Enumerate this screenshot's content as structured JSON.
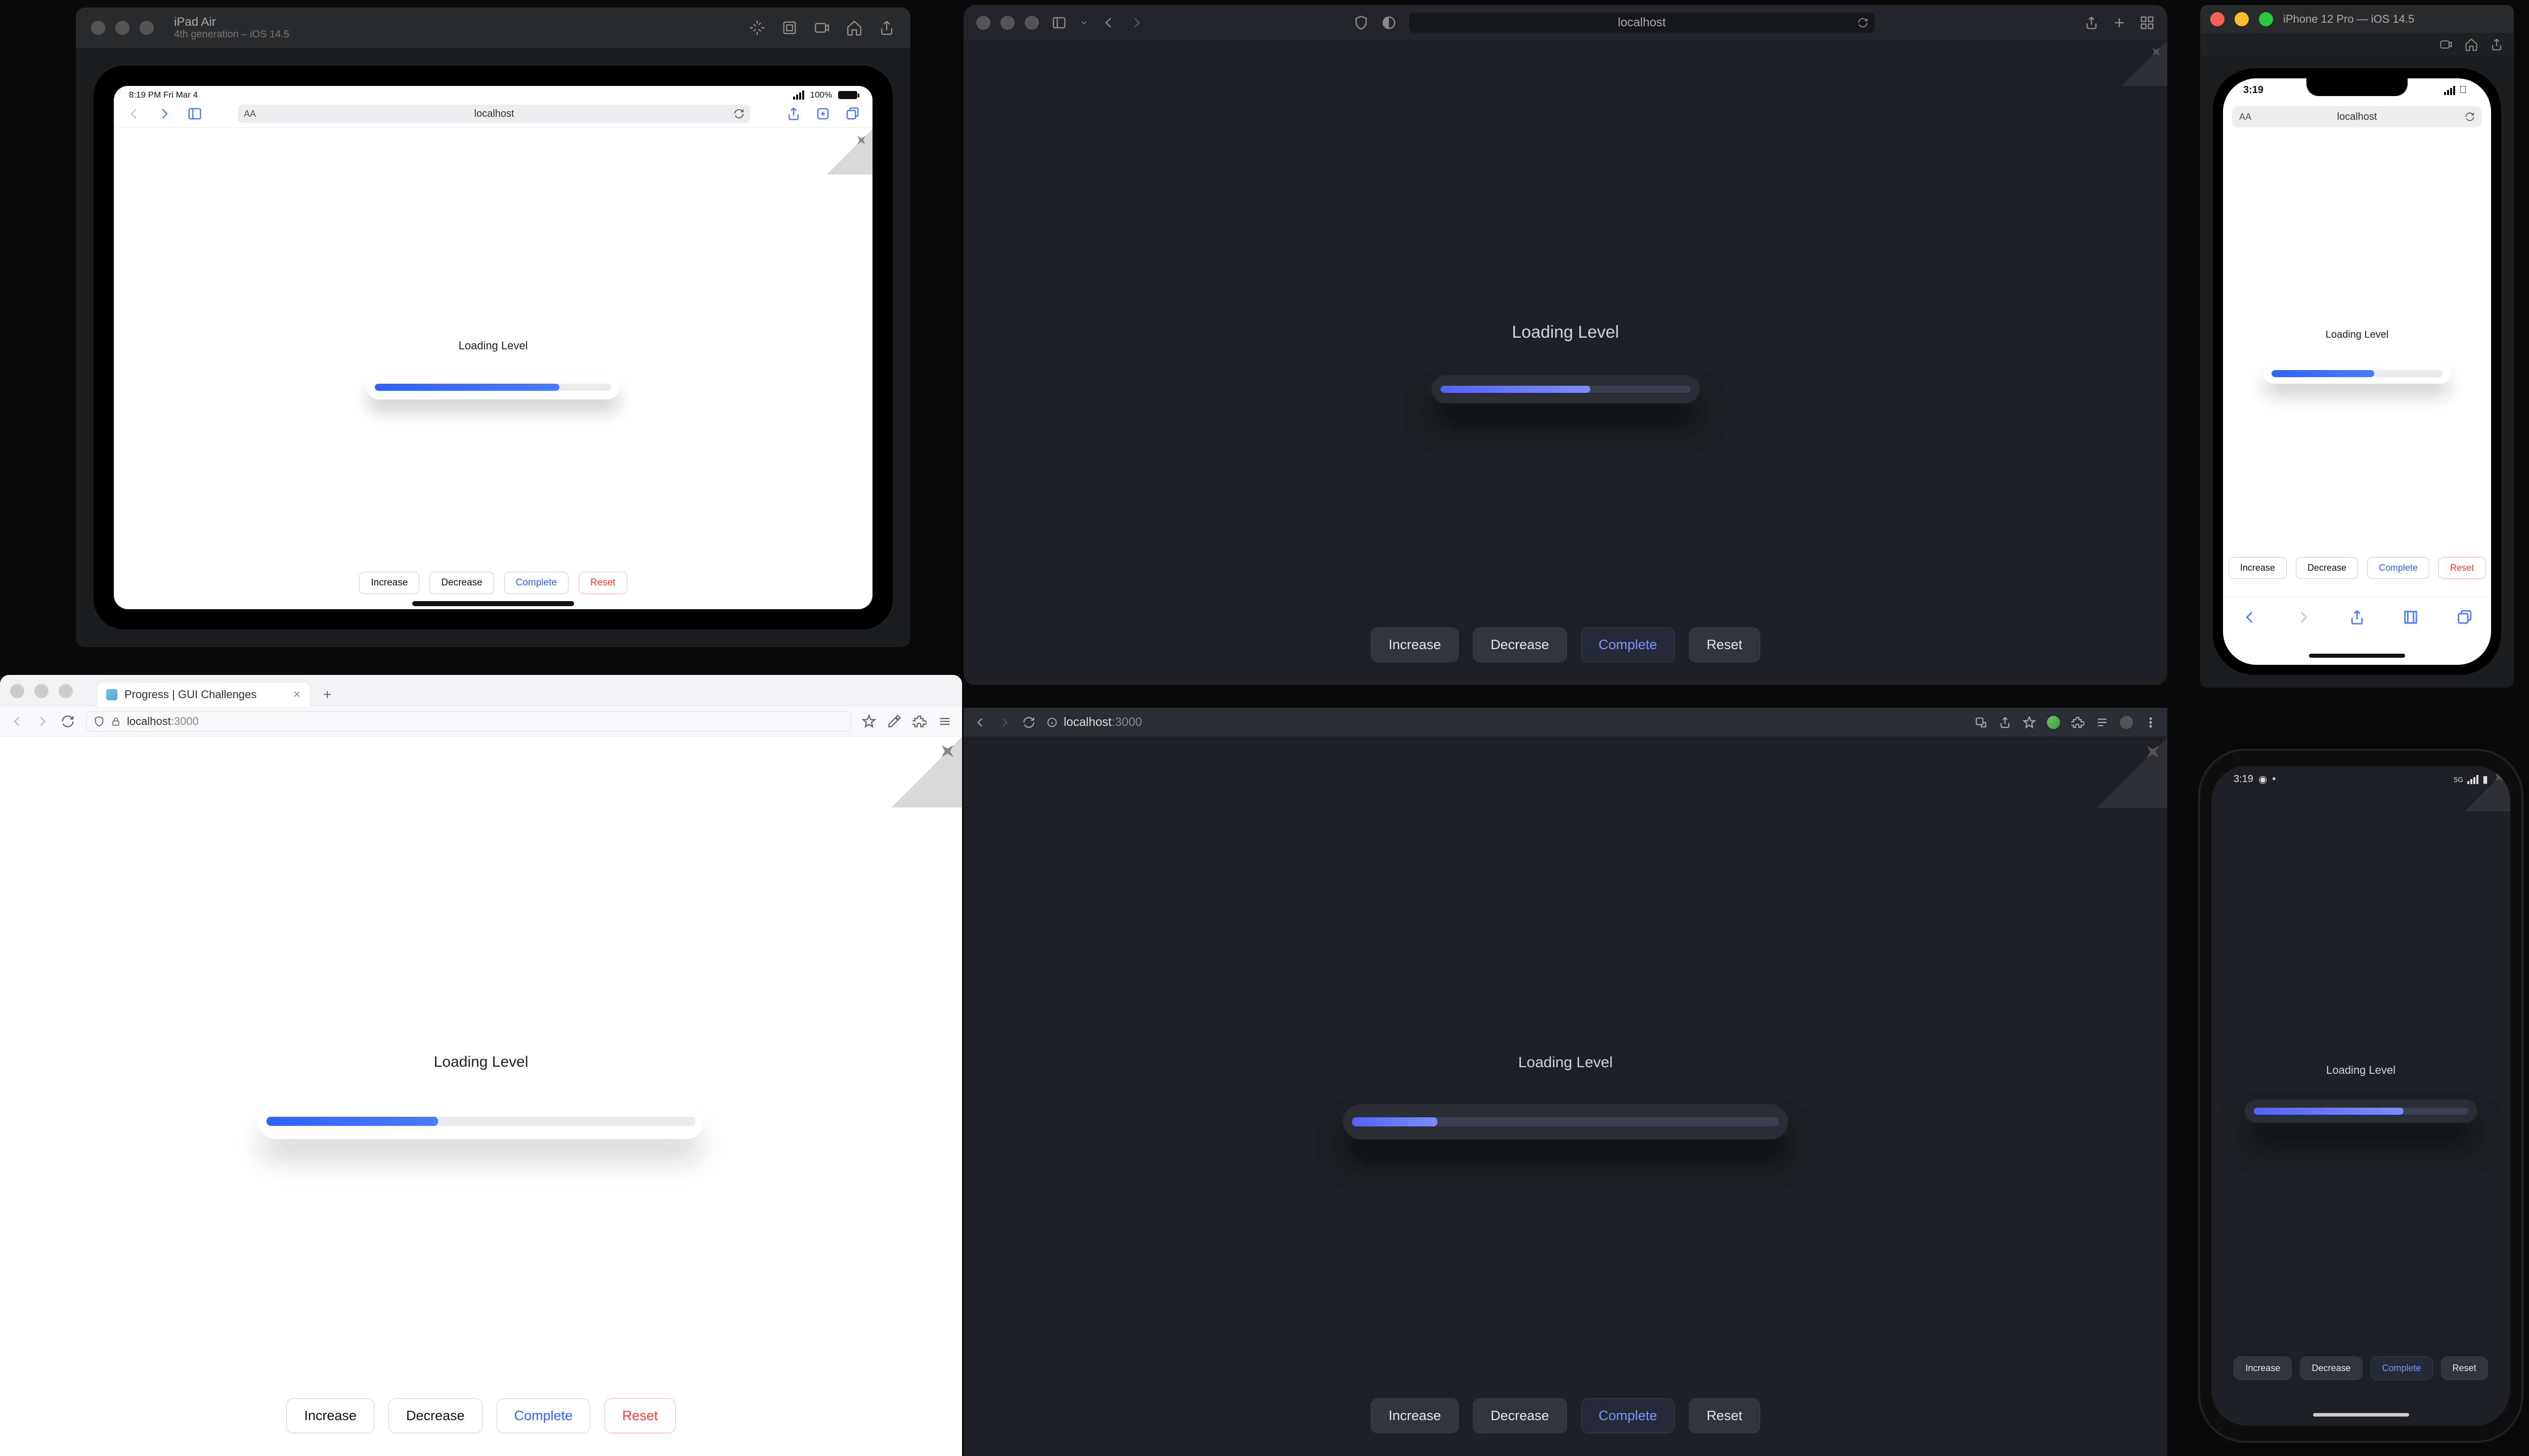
{
  "app": {
    "loading_label": "Loading Level",
    "buttons": {
      "increase": "Increase",
      "decrease": "Decrease",
      "complete": "Complete",
      "reset": "Reset"
    }
  },
  "url": {
    "host": "localhost",
    "port": ":3000"
  },
  "ipad": {
    "win_title": "iPad Air",
    "win_sub": "4th generation – iOS 14.5",
    "status_left": "8:19 PM   Fri Mar 4",
    "battery": "100%",
    "progress_pct": 78
  },
  "safari_dark": {
    "progress_pct": 60
  },
  "iphone": {
    "win_title": "iPhone 12 Pro — iOS 14.5",
    "time": "3:19",
    "progress_pct": 60
  },
  "firefox": {
    "tab_title": "Progress | GUI Challenges",
    "progress_pct": 40
  },
  "chrome": {
    "progress_pct": 20
  },
  "android": {
    "time": "3:19",
    "progress_pct": 70
  },
  "colors": {
    "accent_light": "#2f62ff",
    "accent_dark": "#7d8dff",
    "reset": "#ff3b30",
    "bg_dark": "#1e2025"
  }
}
